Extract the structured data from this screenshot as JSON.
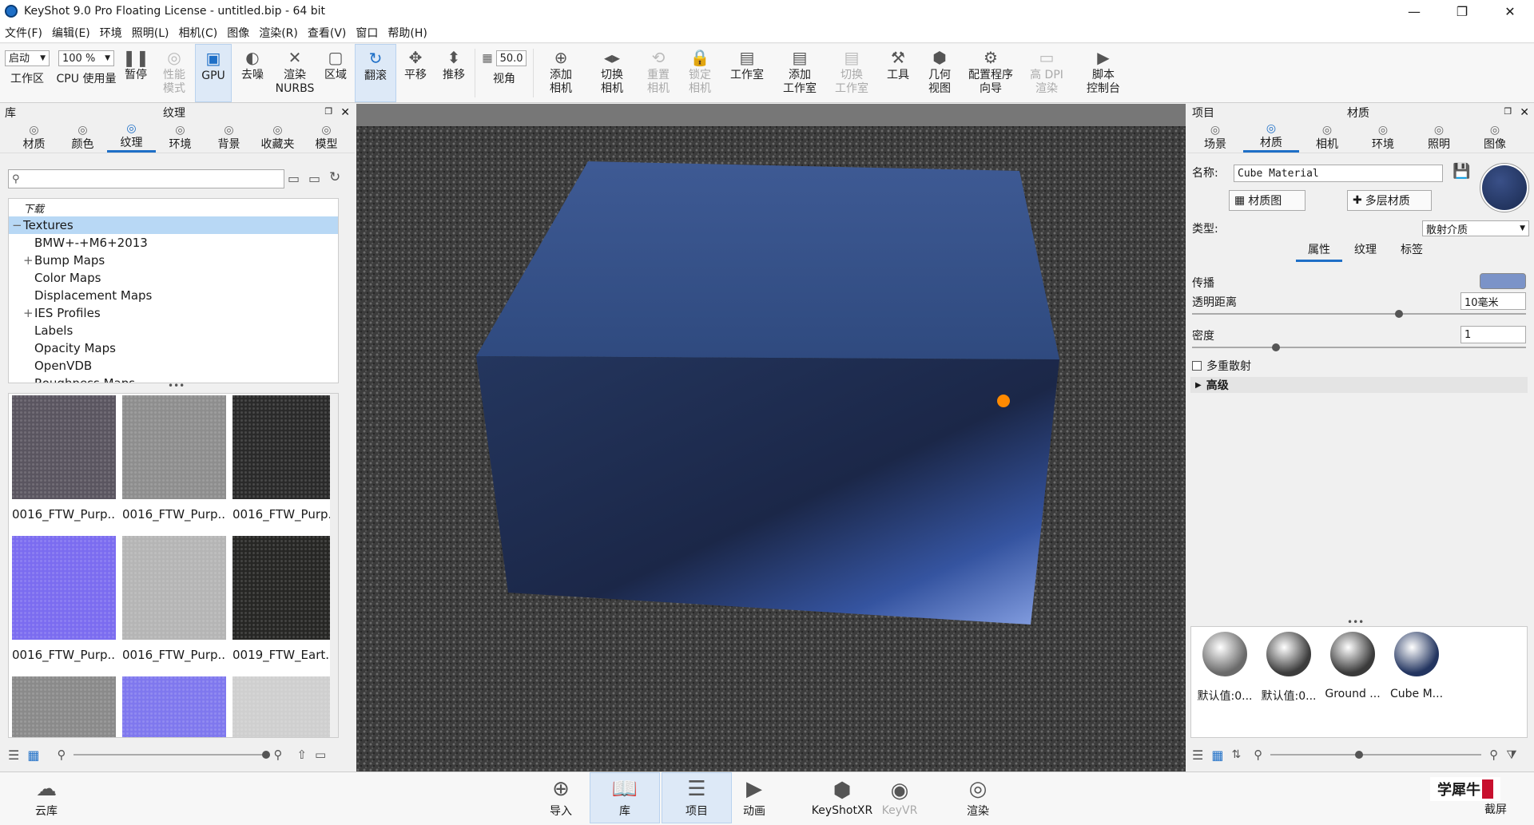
{
  "window": {
    "title": "KeyShot 9.0 Pro Floating License  - untitled.bip  - 64 bit"
  },
  "menu": [
    "文件(F)",
    "编辑(E)",
    "环境",
    "照明(L)",
    "相机(C)",
    "图像",
    "渲染(R)",
    "查看(V)",
    "窗口",
    "帮助(H)"
  ],
  "toolbar": {
    "workspace_value": "启动",
    "workspace_label": "工作区",
    "cpu_value": "100 %",
    "cpu_label": "CPU 使用量",
    "items": [
      {
        "label": "暂停",
        "icon": "pause-icon",
        "glyph": "❚❚"
      },
      {
        "label": "性能\n模式",
        "icon": "performance-icon",
        "glyph": "◎",
        "disabled": true
      },
      {
        "label": "GPU",
        "icon": "gpu-icon",
        "glyph": "▣",
        "active": true
      },
      {
        "label": "去噪",
        "icon": "denoise-icon",
        "glyph": "◐"
      },
      {
        "label": "渲染\nNURBS",
        "icon": "nurbs-icon",
        "glyph": "✕"
      },
      {
        "label": "区域",
        "icon": "region-icon",
        "glyph": "▢"
      },
      {
        "label": "翻滚",
        "icon": "tumble-icon",
        "glyph": "↻",
        "active": true
      },
      {
        "label": "平移",
        "icon": "pan-icon",
        "glyph": "✥"
      },
      {
        "label": "推移",
        "icon": "dolly-icon",
        "glyph": "⬍"
      }
    ],
    "fov_value": "50.0",
    "fov_label": "视角",
    "items2": [
      {
        "label": "添加\n相机",
        "icon": "add-camera-icon",
        "glyph": "⊕"
      },
      {
        "label": "切换\n相机",
        "icon": "switch-camera-icon",
        "glyph": "◂▸"
      },
      {
        "label": "重置\n相机",
        "icon": "reset-camera-icon",
        "glyph": "⟲",
        "disabled": true
      },
      {
        "label": "锁定\n相机",
        "icon": "lock-camera-icon",
        "glyph": "🔒",
        "disabled": true
      },
      {
        "label": "工作室",
        "icon": "studio-icon",
        "glyph": "▤"
      },
      {
        "label": "添加\n工作室",
        "icon": "add-studio-icon",
        "glyph": "▤"
      },
      {
        "label": "切换\n工作室",
        "icon": "switch-studio-icon",
        "glyph": "▤",
        "disabled": true
      },
      {
        "label": "工具",
        "icon": "tools-icon",
        "glyph": "⚒"
      },
      {
        "label": "几何\n视图",
        "icon": "geometry-view-icon",
        "glyph": "⬢"
      },
      {
        "label": "配置程序\n向导",
        "icon": "configurator-icon",
        "glyph": "⚙"
      },
      {
        "label": "高 DPI\n渲染",
        "icon": "high-dpi-icon",
        "glyph": "▭",
        "disabled": true
      },
      {
        "label": "脚本\n控制台",
        "icon": "script-console-icon",
        "glyph": "▶"
      }
    ]
  },
  "library": {
    "title": "库",
    "subtitle": "纹理",
    "tabs": [
      {
        "label": "材质",
        "icon": "material-icon"
      },
      {
        "label": "颜色",
        "icon": "color-icon"
      },
      {
        "label": "纹理",
        "icon": "texture-icon",
        "selected": true
      },
      {
        "label": "环境",
        "icon": "environment-icon"
      },
      {
        "label": "背景",
        "icon": "background-icon"
      },
      {
        "label": "收藏夹",
        "icon": "favorites-icon"
      },
      {
        "label": "模型",
        "icon": "model-icon"
      }
    ],
    "search_placeholder": "",
    "tree": [
      {
        "label": "下载",
        "indent": 0,
        "italic": true
      },
      {
        "label": "Textures",
        "indent": 0,
        "selected": true,
        "expander": "−"
      },
      {
        "label": "BMW+-+M6+2013",
        "indent": 1
      },
      {
        "label": "Bump Maps",
        "indent": 1,
        "expander": "+"
      },
      {
        "label": "Color Maps",
        "indent": 1
      },
      {
        "label": "Displacement Maps",
        "indent": 1
      },
      {
        "label": "IES Profiles",
        "indent": 1,
        "expander": "+"
      },
      {
        "label": "Labels",
        "indent": 1
      },
      {
        "label": "Opacity Maps",
        "indent": 1
      },
      {
        "label": "OpenVDB",
        "indent": 1
      },
      {
        "label": "Roughness Maps",
        "indent": 1
      }
    ],
    "thumbnails": [
      {
        "label": "0016_FTW_Purp...",
        "color": "#5a5560"
      },
      {
        "label": "0016_FTW_Purp...",
        "color": "#8e8e8e"
      },
      {
        "label": "0016_FTW_Purp...",
        "color": "#2a2a2a"
      },
      {
        "label": "0016_FTW_Purp...",
        "color": "#7b6cf0"
      },
      {
        "label": "0016_FTW_Purp...",
        "color": "#b5b5b5"
      },
      {
        "label": "0019_FTW_Eart...",
        "color": "#262624"
      },
      {
        "label": "",
        "color": "#8a8a8a"
      },
      {
        "label": "",
        "color": "#7f78ee"
      },
      {
        "label": "",
        "color": "#cfcfcf"
      }
    ]
  },
  "project": {
    "title": "项目",
    "subtitle": "材质",
    "tabs": [
      {
        "label": "场景",
        "icon": "scene-icon"
      },
      {
        "label": "材质",
        "icon": "material-icon",
        "selected": true
      },
      {
        "label": "相机",
        "icon": "camera-icon"
      },
      {
        "label": "环境",
        "icon": "environment-icon"
      },
      {
        "label": "照明",
        "icon": "lighting-icon"
      },
      {
        "label": "图像",
        "icon": "image-icon"
      }
    ],
    "name_label": "名称:",
    "name_value": "Cube Material",
    "material_graph": "材质图",
    "multi_material": "多层材质",
    "type_label": "类型:",
    "type_value": "散射介质",
    "subtabs": [
      "属性",
      "纹理",
      "标签"
    ],
    "transmission_label": "传播",
    "transmission_color": "#7b93c8",
    "distance_label": "透明距离",
    "distance_value": "10毫米",
    "distance_level": 0.62,
    "density_label": "密度",
    "density_value": "1",
    "density_level": 0.25,
    "multi_scatter_label": "多重散射",
    "advanced_label": "高级",
    "swatch_color": "#233560",
    "materials": [
      {
        "label": "默认值:0...",
        "color": "#6a6a6a"
      },
      {
        "label": "默认值:0...",
        "color": "#3c3c3c"
      },
      {
        "label": "Ground ...",
        "color": "#3a3a3a"
      },
      {
        "label": "Cube M...",
        "color": "#233560"
      }
    ]
  },
  "bottom": {
    "cloud": "云库",
    "items": [
      {
        "label": "导入",
        "icon": "import-icon",
        "glyph": "⊕"
      },
      {
        "label": "库",
        "icon": "library-icon",
        "glyph": "📖",
        "active": true
      },
      {
        "label": "项目",
        "icon": "project-icon",
        "glyph": "☰",
        "active": true
      },
      {
        "label": "动画",
        "icon": "animation-icon",
        "glyph": "▶"
      },
      {
        "label": "KeyShotXR",
        "icon": "keyshotxr-icon",
        "glyph": "⬢"
      },
      {
        "label": "KeyVR",
        "icon": "keyvr-icon",
        "glyph": "◉",
        "disabled": true
      },
      {
        "label": "渲染",
        "icon": "render-icon",
        "glyph": "◎"
      }
    ],
    "screenshot": "截屏",
    "watermark": "学犀牛"
  }
}
